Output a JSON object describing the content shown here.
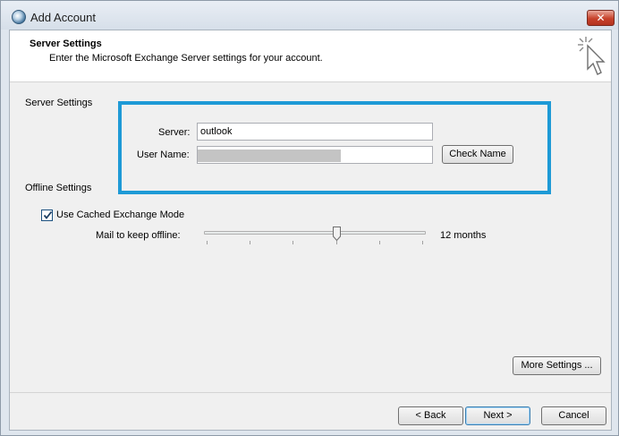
{
  "window": {
    "title": "Add Account",
    "close_glyph": "✕"
  },
  "header": {
    "title": "Server Settings",
    "subtitle": "Enter the Microsoft Exchange Server settings for your account."
  },
  "server_settings": {
    "section_label": "Server Settings",
    "server_label": "Server:",
    "server_value": "outlook",
    "username_label": "User Name:",
    "username_value": "",
    "check_name_label": "Check Name"
  },
  "offline_settings": {
    "section_label": "Offline Settings",
    "cached_mode_label": "Use Cached Exchange Mode",
    "cached_mode_checked": true,
    "mail_offline_label": "Mail to keep offline:",
    "mail_offline_value": "12 months",
    "slider_position": 0.6
  },
  "buttons": {
    "more_settings": "More Settings ...",
    "back": "< Back",
    "next": "Next >",
    "cancel": "Cancel"
  },
  "colors": {
    "highlight": "#1e9ad6",
    "close_button": "#c7422b"
  },
  "icons": {
    "app": "outlook-globe-icon",
    "header": "cursor-sparkle-icon",
    "close": "close-icon"
  }
}
